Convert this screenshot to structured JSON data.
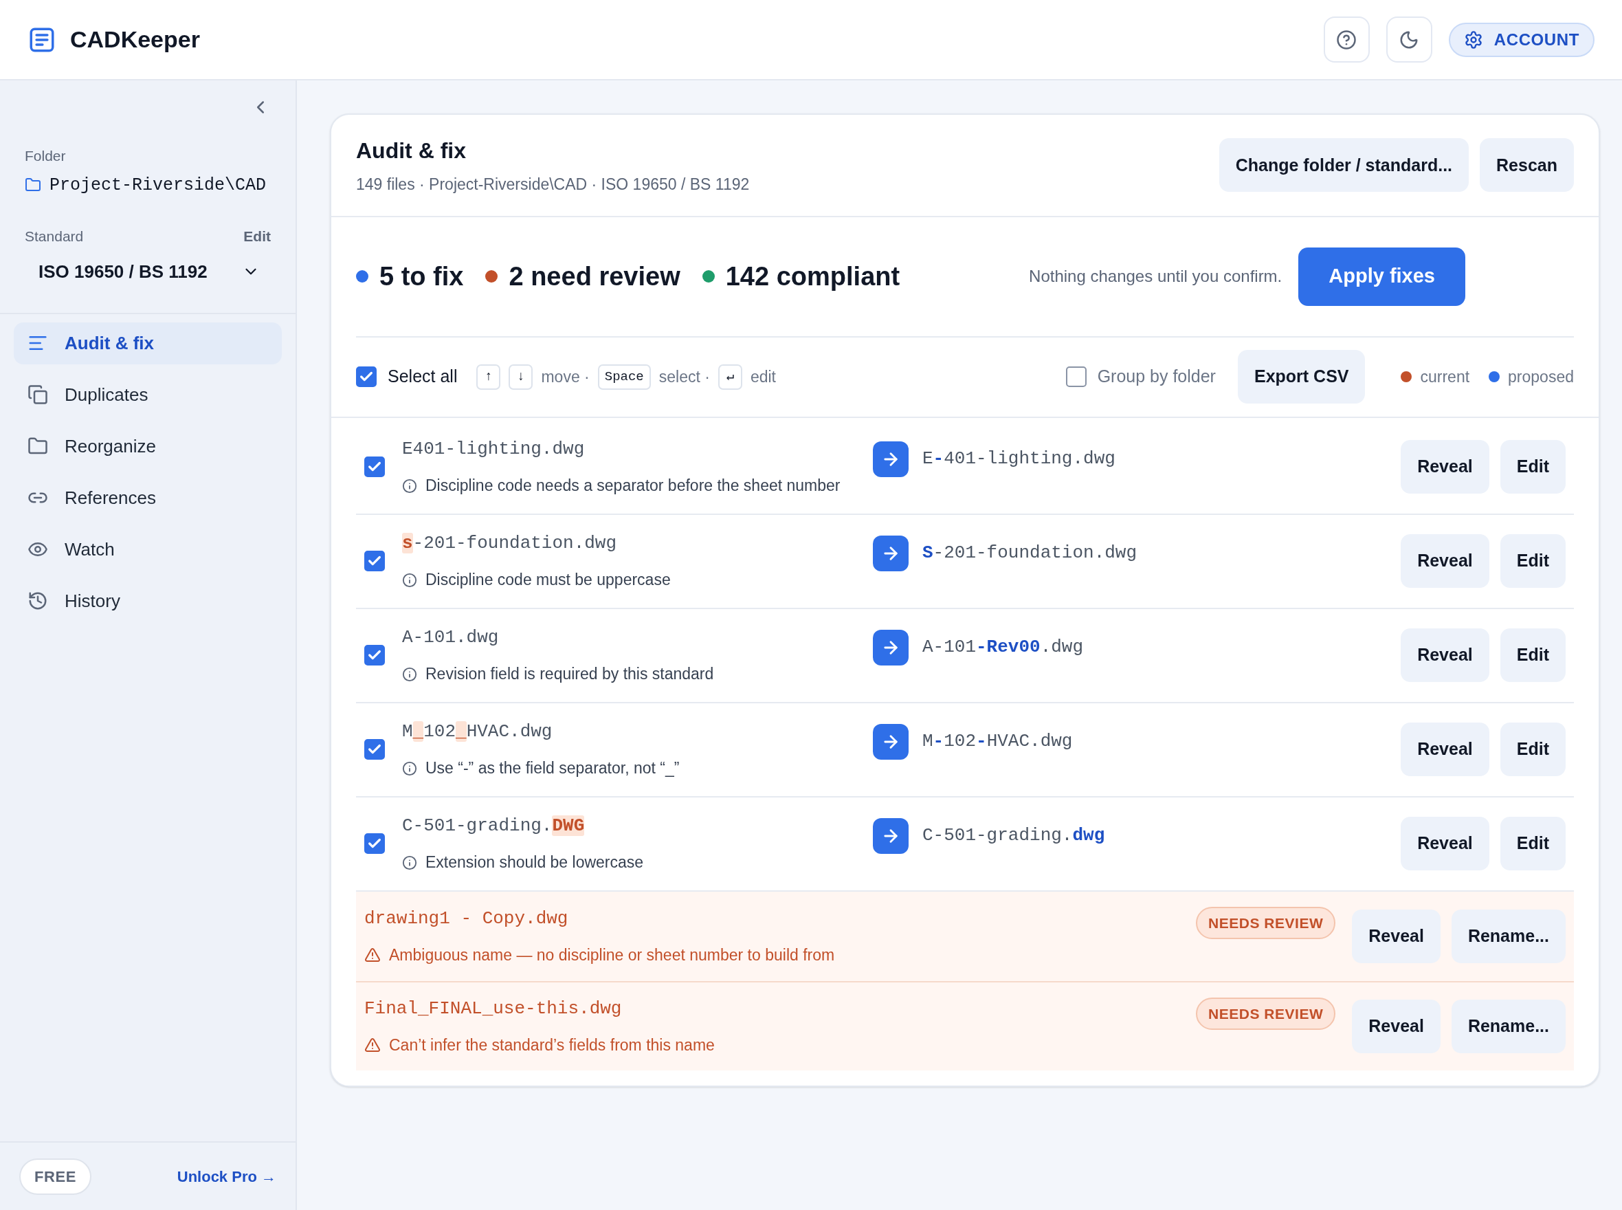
{
  "app": {
    "name": "CADKeeper"
  },
  "header": {
    "account_label": "ACCOUNT"
  },
  "sidebar": {
    "folder_label": "Folder",
    "folder": "Project-Riverside\\CAD",
    "standard_label": "Standard",
    "standard_edit": "Edit",
    "standard": "ISO 19650 / BS 1192",
    "items": [
      {
        "label": "Audit & fix",
        "selected": true
      },
      {
        "label": "Duplicates",
        "selected": false
      },
      {
        "label": "Reorganize",
        "selected": false
      },
      {
        "label": "References",
        "selected": false
      },
      {
        "label": "Watch",
        "selected": false
      },
      {
        "label": "History",
        "selected": false
      }
    ],
    "plan_badge": "FREE",
    "upgrade_link": "Unlock Pro →"
  },
  "card": {
    "title": "Audit & fix",
    "subtitle": "149 files · Project-Riverside\\CAD · ISO 19650 / BS 1192",
    "actions": [
      "Change folder / standard...",
      "Rescan"
    ],
    "summary": [
      {
        "label": "5 to fix",
        "color": "#2f6fe8"
      },
      {
        "label": "2 need review",
        "color": "#c2502a"
      },
      {
        "label": "142 compliant",
        "color": "#1f9d6b"
      }
    ],
    "confirm_note": "Nothing changes until you confirm.",
    "apply_button": "Apply fixes",
    "toolbar": {
      "select_all": {
        "label": "Select all",
        "checked": true
      },
      "hints": [
        {
          "kind": "key",
          "text": "↑"
        },
        {
          "kind": "key",
          "text": "↓"
        },
        {
          "kind": "text",
          "text": "move ·"
        },
        {
          "kind": "key",
          "text": "Space"
        },
        {
          "kind": "text",
          "text": "select ·"
        },
        {
          "kind": "key",
          "text": "↵"
        },
        {
          "kind": "text",
          "text": "edit"
        }
      ],
      "group_by_folder": {
        "label": "Group by folder",
        "checked": false
      },
      "export": "Export CSV",
      "legend": [
        {
          "label": "current",
          "color": "#c2502a"
        },
        {
          "label": "proposed",
          "color": "#2f6fe8"
        }
      ]
    },
    "fixes": [
      {
        "checked": true,
        "current": [
          {
            "text": "E401-lighting.dwg",
            "flag": false
          }
        ],
        "proposed": [
          {
            "text": "E",
            "fix": false
          },
          {
            "text": "-",
            "fix": true
          },
          {
            "text": "401-lighting.dwg",
            "fix": false
          }
        ],
        "reason": "Discipline code needs a separator before the sheet number",
        "actions": [
          "Reveal",
          "Edit"
        ]
      },
      {
        "checked": true,
        "current": [
          {
            "text": "s",
            "flag": true
          },
          {
            "text": "-201-foundation.dwg",
            "flag": false
          }
        ],
        "proposed": [
          {
            "text": "S",
            "fix": true
          },
          {
            "text": "-201-foundation.dwg",
            "fix": false
          }
        ],
        "reason": "Discipline code must be uppercase",
        "actions": [
          "Reveal",
          "Edit"
        ]
      },
      {
        "checked": true,
        "current": [
          {
            "text": "A-101.dwg",
            "flag": false
          }
        ],
        "proposed": [
          {
            "text": "A-101",
            "fix": false
          },
          {
            "text": "-Rev00",
            "fix": true
          },
          {
            "text": ".dwg",
            "fix": false
          }
        ],
        "reason": "Revision field is required by this standard",
        "actions": [
          "Reveal",
          "Edit"
        ]
      },
      {
        "checked": true,
        "current": [
          {
            "text": "M",
            "flag": false
          },
          {
            "text": "_",
            "flag": true
          },
          {
            "text": "102",
            "flag": false
          },
          {
            "text": "_",
            "flag": true
          },
          {
            "text": "HVAC.dwg",
            "flag": false
          }
        ],
        "proposed": [
          {
            "text": "M",
            "fix": false
          },
          {
            "text": "-",
            "fix": true
          },
          {
            "text": "102",
            "fix": false
          },
          {
            "text": "-",
            "fix": true
          },
          {
            "text": "HVAC.dwg",
            "fix": false
          }
        ],
        "reason": "Use “-” as the field separator, not “_”",
        "actions": [
          "Reveal",
          "Edit"
        ]
      },
      {
        "checked": true,
        "current": [
          {
            "text": "C-501-grading.",
            "flag": false
          },
          {
            "text": "DWG",
            "flag": true
          }
        ],
        "proposed": [
          {
            "text": "C-501-grading.",
            "fix": false
          },
          {
            "text": "dwg",
            "fix": true
          }
        ],
        "reason": "Extension should be lowercase",
        "actions": [
          "Reveal",
          "Edit"
        ]
      }
    ],
    "reviews": [
      {
        "name": "drawing1 - Copy.dwg",
        "badge": "NEEDS REVIEW",
        "reason": "Ambiguous name — no discipline or sheet number to build from",
        "actions": [
          "Reveal",
          "Rename..."
        ]
      },
      {
        "name": "Final_FINAL_use-this.dwg",
        "badge": "NEEDS REVIEW",
        "reason": "Can’t infer the standard’s fields from this name",
        "actions": [
          "Reveal",
          "Rename..."
        ]
      }
    ]
  }
}
